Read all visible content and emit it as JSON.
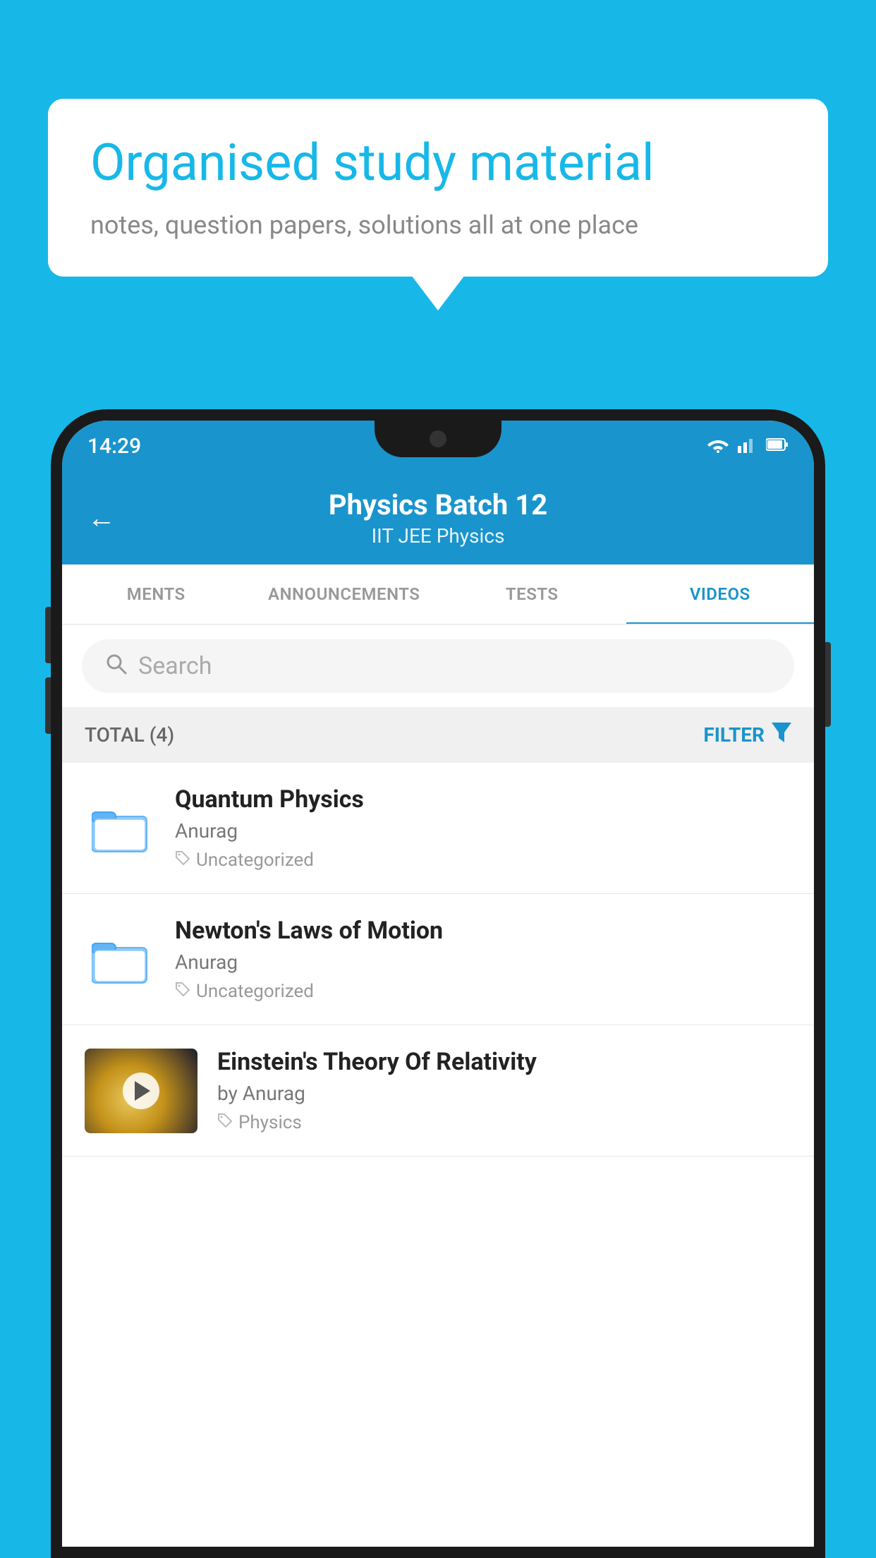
{
  "background_color": "#17b8e8",
  "speech_bubble": {
    "title": "Organised study material",
    "subtitle": "notes, question papers, solutions all at one place"
  },
  "status_bar": {
    "time": "14:29",
    "wifi": "▼",
    "signal": "▲",
    "battery": "▮"
  },
  "app_header": {
    "back_label": "←",
    "title": "Physics Batch 12",
    "subtitle": "IIT JEE   Physics"
  },
  "tabs": [
    {
      "label": "MENTS",
      "active": false
    },
    {
      "label": "ANNOUNCEMENTS",
      "active": false
    },
    {
      "label": "TESTS",
      "active": false
    },
    {
      "label": "VIDEOS",
      "active": true
    }
  ],
  "search": {
    "placeholder": "Search"
  },
  "filter_row": {
    "total": "TOTAL (4)",
    "filter_label": "FILTER"
  },
  "videos": [
    {
      "id": 1,
      "title": "Quantum Physics",
      "author": "Anurag",
      "tag": "Uncategorized",
      "has_thumbnail": false
    },
    {
      "id": 2,
      "title": "Newton's Laws of Motion",
      "author": "Anurag",
      "tag": "Uncategorized",
      "has_thumbnail": false
    },
    {
      "id": 3,
      "title": "Einstein's Theory Of Relativity",
      "author": "by Anurag",
      "tag": "Physics",
      "has_thumbnail": true
    }
  ]
}
